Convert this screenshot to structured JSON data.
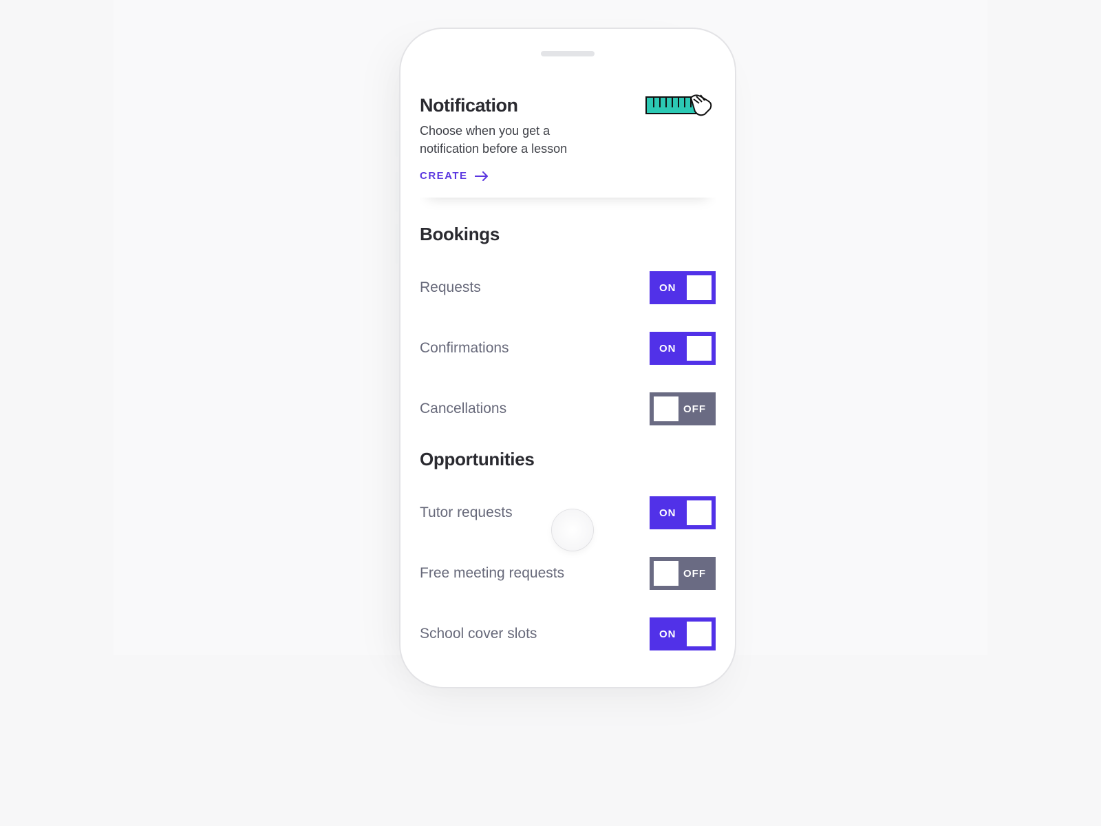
{
  "card": {
    "title": "Notification",
    "description": "Choose when you get a notification before a lesson",
    "cta": "CREATE"
  },
  "toggle_labels": {
    "on": "ON",
    "off": "OFF"
  },
  "sections": {
    "bookings": {
      "title": "Bookings",
      "items": [
        {
          "label": "Requests",
          "state": "on"
        },
        {
          "label": "Confirmations",
          "state": "on"
        },
        {
          "label": "Cancellations",
          "state": "off"
        }
      ]
    },
    "opportunities": {
      "title": "Opportunities",
      "items": [
        {
          "label": "Tutor requests",
          "state": "on"
        },
        {
          "label": "Free meeting requests",
          "state": "off"
        },
        {
          "label": "School cover slots",
          "state": "on"
        }
      ]
    }
  },
  "colors": {
    "accent": "#5131e8",
    "muted_toggle": "#6a6b83",
    "teal": "#2cc9b4"
  }
}
